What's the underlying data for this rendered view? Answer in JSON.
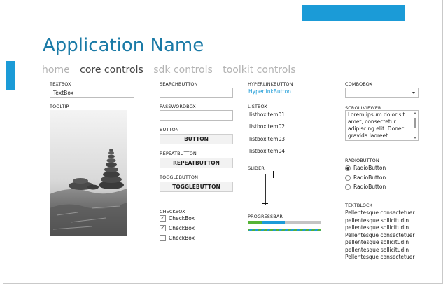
{
  "app": {
    "title": "Application Name"
  },
  "nav": [
    {
      "label": "home",
      "active": false
    },
    {
      "label": "core controls",
      "active": true
    },
    {
      "label": "sdk controls",
      "active": false
    },
    {
      "label": "toolkit controls",
      "active": false
    }
  ],
  "textbox": {
    "label": "TEXTBOX",
    "value": "TextBox"
  },
  "tooltip": {
    "label": "TOOLTIP",
    "image": "stacked-stones-photo"
  },
  "searchbutton": {
    "label": "SEARCHBUTTON",
    "value": "",
    "icon": "search-icon"
  },
  "passwordbox": {
    "label": "PASSWORDBOX",
    "value": ""
  },
  "button": {
    "label": "BUTTON",
    "text": "BUTTON"
  },
  "repeatbutton": {
    "label": "REPEATBUTTON",
    "text": "REPEATBUTTON"
  },
  "togglebutton": {
    "label": "TOGGLEBUTTON",
    "text": "TOGGLEBUTTON"
  },
  "checkbox": {
    "label": "CHECKBOX",
    "items": [
      {
        "text": "CheckBox",
        "checked": true
      },
      {
        "text": "CheckBox",
        "checked": true
      },
      {
        "text": "CheckBox",
        "checked": false
      }
    ]
  },
  "hyperlinkbutton": {
    "label": "HYPERLINKBUTTON",
    "text": "HyperlinkButton"
  },
  "listbox": {
    "label": "LISTBOX",
    "items": [
      "listboxitem01",
      "listboxitem02",
      "listboxitem03",
      "listboxitem04"
    ]
  },
  "slider": {
    "label": "SLIDER",
    "horizontal_value": 0.05,
    "vertical_value": 0.05
  },
  "progressbar": {
    "label": "PROGRESSBAR",
    "segments": [
      {
        "fraction": 0.2,
        "color": "#55b336"
      },
      {
        "fraction": 0.3,
        "color": "#1b9bd7"
      }
    ],
    "indeterminate_colors": [
      "#55b336",
      "#1b9bd7"
    ]
  },
  "combobox": {
    "label": "COMBOBOX",
    "value": ""
  },
  "scrollviewer": {
    "label": "SCROLLVIEWER",
    "text": "Lorem ipsum dolor sit amet, consectetur adipiscing elit. Donec gravida laoreet vestibulum."
  },
  "radiobutton": {
    "label": "RADIOBUTTON",
    "items": [
      {
        "text": "RadioButton",
        "selected": true
      },
      {
        "text": "RadioButton",
        "selected": false
      },
      {
        "text": "RadioButton",
        "selected": false
      }
    ]
  },
  "textblock": {
    "label": "TEXTBLOCK",
    "lines": [
      "Pellentesque consectetuer",
      "pellentesque sollicitudin",
      "pellentesque sollicitudin",
      "Pellentesque consectetuer",
      "pellentesque sollicitudin",
      "pellentesque sollicitudin",
      "Pellentesque consectetuer"
    ]
  },
  "colors": {
    "accent": "#1b9bd7",
    "title": "#1a7aa6",
    "nav_inactive": "#b3b3b3",
    "nav_active": "#444444"
  }
}
